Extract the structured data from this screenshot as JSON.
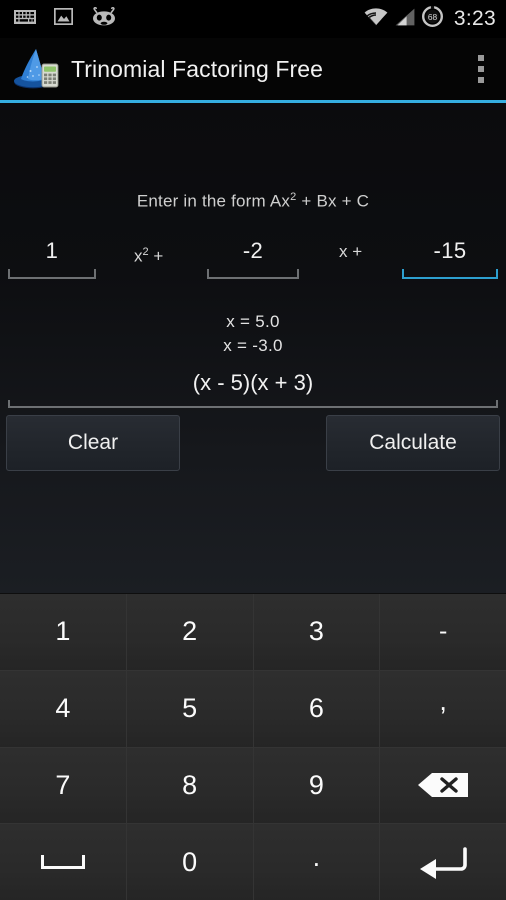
{
  "statusbar": {
    "icons_left": [
      "keyboard-icon",
      "gallery-image-icon",
      "cyanogenmod-icon"
    ],
    "icons_right": [
      "wifi-icon",
      "cell-signal-icon",
      "battery-icon"
    ],
    "battery_level": "68",
    "clock": "3:23"
  },
  "actionbar": {
    "app_icon": "wizard-hat-calculator-icon",
    "title": "Trinomial Factoring Free",
    "overflow_label": "overflow-menu",
    "accent_color": "#35aee0"
  },
  "form": {
    "hint_prefix": "Enter in the form Ax",
    "hint_sup": "2",
    "hint_suffix": " + Bx + C",
    "fields": [
      {
        "name": "coefficient-a",
        "value": "1",
        "focused": false
      },
      {
        "name": "coefficient-b",
        "value": "-2",
        "focused": false
      },
      {
        "name": "coefficient-c",
        "value": "-15",
        "focused": true
      }
    ],
    "label_a_text": "x",
    "label_a_sup": "2",
    "label_a_tail": " +",
    "label_b": "x +"
  },
  "results": {
    "root1": "x = 5.0",
    "root2": "x = -3.0",
    "factored": "(x - 5)(x + 3)"
  },
  "buttons": {
    "clear": "Clear",
    "calculate": "Calculate"
  },
  "keyboard": {
    "rows": [
      [
        {
          "label": "1",
          "name": "key-1"
        },
        {
          "label": "2",
          "name": "key-2"
        },
        {
          "label": "3",
          "name": "key-3"
        },
        {
          "label": "-",
          "name": "key-minus"
        }
      ],
      [
        {
          "label": "4",
          "name": "key-4"
        },
        {
          "label": "5",
          "name": "key-5"
        },
        {
          "label": "6",
          "name": "key-6"
        },
        {
          "label": ",",
          "name": "key-comma"
        }
      ],
      [
        {
          "label": "7",
          "name": "key-7"
        },
        {
          "label": "8",
          "name": "key-8"
        },
        {
          "label": "9",
          "name": "key-9"
        },
        {
          "label": "",
          "name": "key-backspace",
          "icon": "backspace-icon"
        }
      ],
      [
        {
          "label": "",
          "name": "key-space",
          "icon": "spacebar-icon"
        },
        {
          "label": "0",
          "name": "key-0"
        },
        {
          "label": ".",
          "name": "key-period"
        },
        {
          "label": "",
          "name": "key-enter",
          "icon": "enter-return-icon"
        }
      ]
    ]
  }
}
